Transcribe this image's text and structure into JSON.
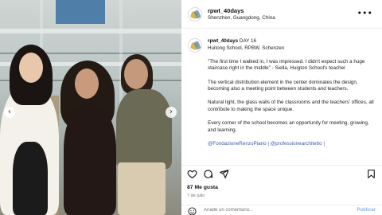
{
  "post": {
    "username": "rpwt_40days",
    "location": "Shenzhen, Guangdong, China",
    "more_icon": "more-horizontal-icon"
  },
  "caption": {
    "username": "rpwt_40days",
    "title": "DAY 16",
    "subtitle": "Huitong School, RPBW, Schenzen",
    "paragraph1": "\"The first time I walked in, I was impressed. I didn't expect such a huge staircase right in the middle\" - Siella, Huigton School's teacher",
    "paragraph2": "The vertical distribution element in the center dominates the design, becoming also a meeting point between students and teachers.",
    "paragraph3": "Natural light, the glass walls of the classrooms and the teachers' offices, all contribute to making the space unique.",
    "paragraph4": "Every corner of the school becomes an opportunity for meeting, growing, and learning.",
    "tags": "@FondazioneRenzoPiano | @professionearchitetto |"
  },
  "actions": {
    "like_icon": "heart-icon",
    "comment_icon": "comment-icon",
    "share_icon": "send-icon",
    "save_icon": "bookmark-icon"
  },
  "likes": "87 Me gusta",
  "date": "7 de julio",
  "comment_bar": {
    "placeholder": "Añade un comentario...",
    "post_label": "Publicar"
  },
  "carousel": {
    "prev_icon": "chevron-left-icon",
    "next_icon": "chevron-right-icon"
  }
}
